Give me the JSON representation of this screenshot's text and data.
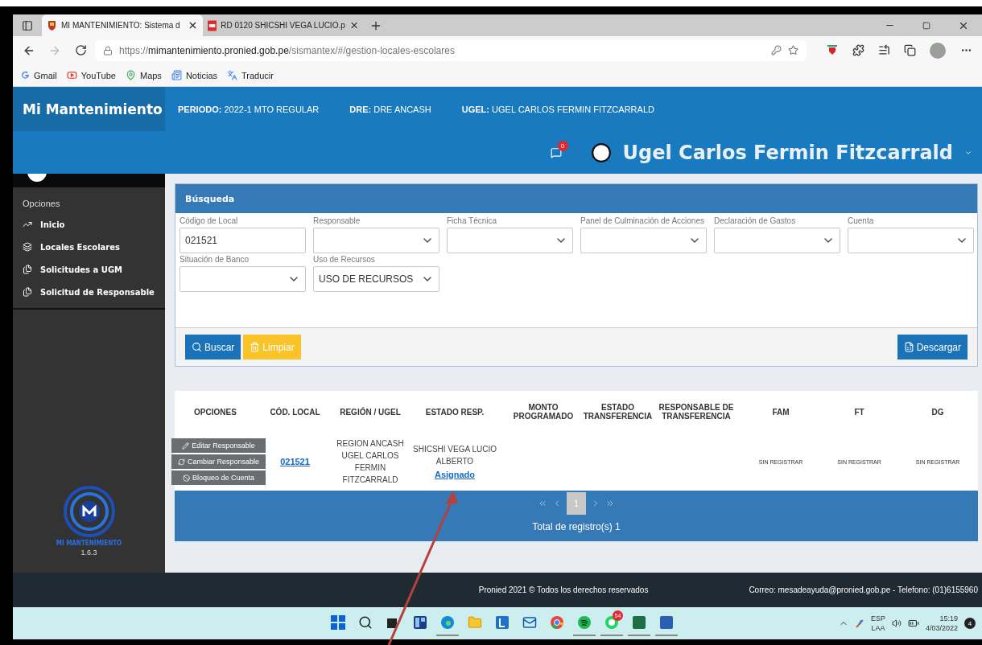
{
  "browser": {
    "tabs": [
      {
        "title": "MI MANTENIMIENTO: Sistema d",
        "kind": "site",
        "selected": true
      },
      {
        "title": "RD 0120 SHICSHI VEGA LUCIO.p",
        "kind": "pdf",
        "selected": false
      }
    ],
    "url": {
      "scheme": "https://",
      "host": "mimantenimiento.pronied.gob.pe",
      "path": "/sismantex/#/gestion-locales-escolares"
    },
    "bookmarks": [
      {
        "label": "Gmail",
        "kind": "google"
      },
      {
        "label": "YouTube",
        "kind": "youtube"
      },
      {
        "label": "Maps",
        "kind": "maps"
      },
      {
        "label": "Noticias",
        "kind": "news"
      },
      {
        "label": "Traducir",
        "kind": "translate"
      }
    ]
  },
  "header": {
    "brand": "Mi Mantenimiento",
    "info": [
      {
        "label": "PERIODO:",
        "value": "2022-1 MTO REGULAR"
      },
      {
        "label": "DRE:",
        "value": "DRE ANCASH"
      },
      {
        "label": "UGEL:",
        "value": "UGEL CARLOS FERMIN FITZCARRALD"
      }
    ],
    "notifications": "0",
    "user": "Ugel Carlos Fermin Fitzcarrald"
  },
  "sidebar": {
    "section": "Opciones",
    "items": [
      {
        "label": "Inicio",
        "kind": "chart"
      },
      {
        "label": "Locales Escolares",
        "kind": "layers"
      },
      {
        "label": "Solicitudes a UGM",
        "kind": "copy"
      },
      {
        "label": "Solicitud de Responsable",
        "kind": "copy"
      }
    ],
    "logo_text": "MI MANTENIMIENTO",
    "version": "1.6.3"
  },
  "search": {
    "title": "Búsqueda",
    "fields": [
      {
        "label": "Código de Local",
        "kind": "input",
        "value": "021521"
      },
      {
        "label": "Responsable",
        "kind": "select"
      },
      {
        "label": "Ficha Técnica",
        "kind": "select"
      },
      {
        "label": "Panel de Culminación de Acciones",
        "kind": "select"
      },
      {
        "label": "Declaración de Gastos",
        "kind": "select"
      },
      {
        "label": "Cuenta",
        "kind": "select"
      },
      {
        "label": "Situación de Banco",
        "kind": "select"
      },
      {
        "label": "Uso de Recursos",
        "kind": "select",
        "value": "USO DE RECURSOS"
      }
    ],
    "buttons": [
      {
        "label": "Buscar",
        "kind": "search"
      },
      {
        "label": "Limpiar",
        "kind": "clear"
      }
    ],
    "download": "Descargar"
  },
  "table": {
    "columns": [
      "OPCIONES",
      "CÓD. LOCAL",
      "REGIÓN / UGEL",
      "ESTADO RESP.",
      "MONTO PROGRAMADO",
      "ESTADO TRANSFERENCIA",
      "RESPONSABLE DE TRANSFERENCIA",
      "FAM",
      "FT",
      "DG"
    ],
    "rows": [
      {
        "options": [
          {
            "label": "Editar Responsable",
            "kind": "edit"
          },
          {
            "label": "Cambiar Responsable",
            "kind": "change"
          },
          {
            "label": "Bloqueo de Cuenta",
            "kind": "block"
          }
        ],
        "code": "021521",
        "region": "REGION ANCASH UGEL CARLOS FERMIN FITZCARRALD",
        "responsible": "SHICSHI VEGA LUCIO ALBERTO",
        "status": "Asignado",
        "fam": "SIN REGISTRAR",
        "ft": "SIN REGISTRAR",
        "dg": "SIN REGISTRAR"
      }
    ],
    "pagination": {
      "pages": [
        {
          "label": "1",
          "selected": true
        }
      ]
    },
    "total": "Total de registro(s) 1"
  },
  "footer": {
    "copyright": "Pronied 2021 © Todos los derechos reservados",
    "contact": "Correo: mesadeayuda@pronied.gob.pe - Telefono: (01)6155960"
  },
  "taskbar": {
    "apps": [
      {
        "kind": "start"
      },
      {
        "kind": "search"
      },
      {
        "kind": "widgets"
      },
      {
        "kind": "snap"
      },
      {
        "kind": "edge",
        "running": true
      },
      {
        "kind": "folder"
      },
      {
        "kind": "l-app"
      },
      {
        "kind": "mail"
      },
      {
        "kind": "chrome"
      },
      {
        "kind": "spotify",
        "running": true
      },
      {
        "kind": "whatsapp",
        "badge": "54",
        "running": true
      },
      {
        "kind": "excel",
        "running": true
      },
      {
        "kind": "word",
        "running": true
      }
    ],
    "lang": [
      "ESP",
      "LAA"
    ],
    "time": "15:19",
    "date": "4/03/2022",
    "notifications": "4"
  }
}
